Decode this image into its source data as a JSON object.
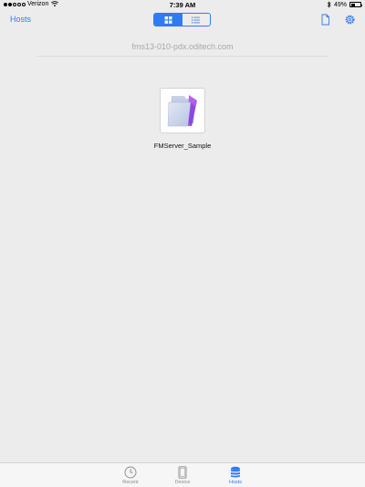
{
  "status_bar": {
    "carrier": "Verizon",
    "time": "7:39 AM",
    "battery": "49%",
    "battery_level": 0.49,
    "signal_bars_filled": 2,
    "signal_bars_total": 5
  },
  "nav": {
    "back_label": "Hosts",
    "view_modes": [
      "grid",
      "list"
    ],
    "active_view": "grid",
    "icons": [
      "new-document-icon",
      "settings-gear-icon"
    ]
  },
  "server": {
    "name": "fms13-010-pdx.oditech.com"
  },
  "files": [
    {
      "name": "FMServer_Sample",
      "icon": "filemaker-folder-icon"
    }
  ],
  "tabs": [
    {
      "label": "Recent",
      "icon": "clock-icon",
      "active": false
    },
    {
      "label": "Device",
      "icon": "ipad-icon",
      "active": false
    },
    {
      "label": "Hosts",
      "icon": "database-icon",
      "active": true
    }
  ],
  "colors": {
    "accent": "#2f7bf6",
    "background": "#ececec",
    "tab_bar": "#f6f6f6",
    "server_text": "#a8a8a8"
  }
}
